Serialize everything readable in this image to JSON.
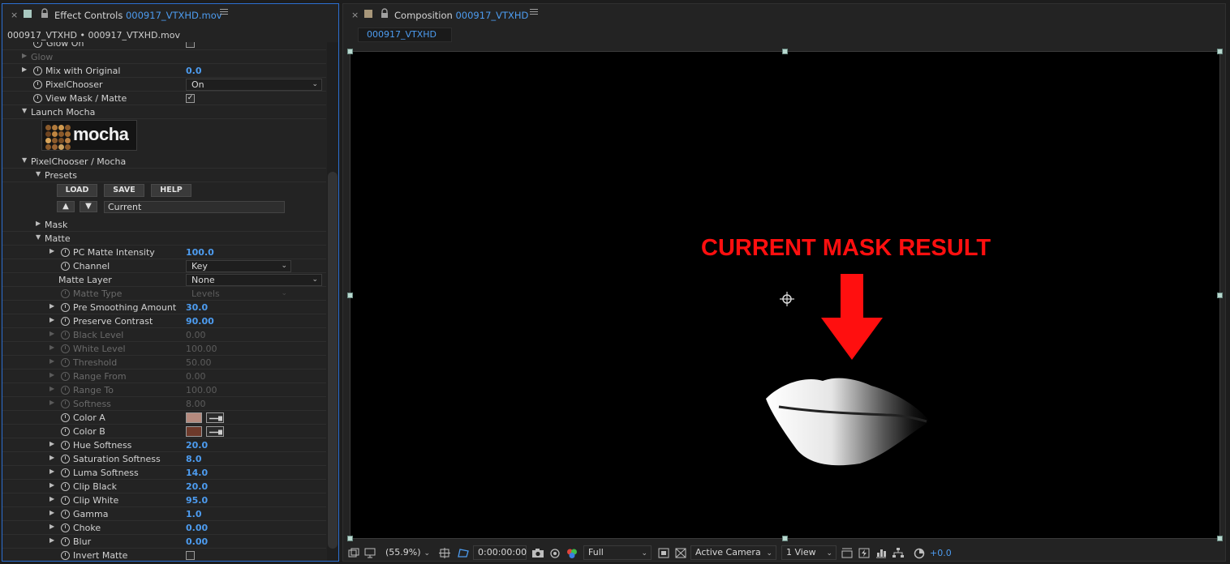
{
  "left_panel": {
    "tab_close": "×",
    "tab_title_prefix": "Effect Controls",
    "tab_title_file": "000917_VTXHD.mov",
    "breadcrumb": "000917_VTXHD • 000917_VTXHD.mov",
    "rows": {
      "glow_on": "Glow On",
      "glow": "Glow",
      "mix_with_original": {
        "label": "Mix with Original",
        "value": "0.0"
      },
      "pixelchooser": {
        "label": "PixelChooser",
        "value": "On"
      },
      "view_mask_matte": {
        "label": "View Mask / Matte",
        "checked": true
      },
      "launch_mocha": "Launch Mocha",
      "mocha_logo_text": "mocha",
      "pixelchooser_mocha": "PixelChooser / Mocha",
      "presets": "Presets",
      "mask": "Mask",
      "matte": "Matte",
      "pc_matte_intensity": {
        "label": "PC Matte Intensity",
        "value": "100.0"
      },
      "channel": {
        "label": "Channel",
        "value": "Key"
      },
      "matte_layer": {
        "label": "Matte Layer",
        "value": "None"
      },
      "matte_type": {
        "label": "Matte Type",
        "value": "Levels"
      },
      "pre_smoothing_amount": {
        "label": "Pre Smoothing Amount",
        "value": "30.0"
      },
      "preserve_contrast": {
        "label": "Preserve Contrast",
        "value": "90.00"
      },
      "black_level": {
        "label": "Black Level",
        "value": "0.00"
      },
      "white_level": {
        "label": "White Level",
        "value": "100.00"
      },
      "threshold": {
        "label": "Threshold",
        "value": "50.00"
      },
      "range_from": {
        "label": "Range From",
        "value": "0.00"
      },
      "range_to": {
        "label": "Range To",
        "value": "100.00"
      },
      "softness": {
        "label": "Softness",
        "value": "8.00"
      },
      "color_a": {
        "label": "Color A",
        "color": "#b58a7e"
      },
      "color_b": {
        "label": "Color B",
        "color": "#6e3a2b"
      },
      "hue_softness": {
        "label": "Hue Softness",
        "value": "20.0"
      },
      "saturation_softness": {
        "label": "Saturation Softness",
        "value": "8.0"
      },
      "luma_softness": {
        "label": "Luma Softness",
        "value": "14.0"
      },
      "clip_black": {
        "label": "Clip Black",
        "value": "20.0"
      },
      "clip_white": {
        "label": "Clip White",
        "value": "95.0"
      },
      "gamma": {
        "label": "Gamma",
        "value": "1.0"
      },
      "choke": {
        "label": "Choke",
        "value": "0.00"
      },
      "blur": {
        "label": "Blur",
        "value": "0.00"
      },
      "invert_matte": {
        "label": "Invert Matte",
        "checked": false
      }
    },
    "preset_buttons": {
      "load": "LOAD",
      "save": "SAVE",
      "help": "HELP"
    },
    "preset_up": "▲",
    "preset_down": "▼",
    "preset_name": "Current"
  },
  "right_panel": {
    "tab_close": "×",
    "tab_title_prefix": "Composition",
    "tab_title_comp": "000917_VTXHD",
    "subtab": "000917_VTXHD",
    "annotation": "CURRENT MASK RESULT",
    "toolbar": {
      "magnification": "(55.9%)",
      "timecode": "0:00:00:00",
      "resolution": "Full",
      "camera": "Active Camera",
      "views": "1 View",
      "exposure": "+0.0"
    }
  },
  "colors": {
    "accent_blue": "#4d9cf0",
    "annotation_red": "#ff0f0f",
    "effect_label_swatch": "#a9c8c0",
    "comp_label_swatch": "#a8977a"
  },
  "icons": [
    "close-icon",
    "label-swatch",
    "lock-icon",
    "panel-menu-icon",
    "stopwatch-icon",
    "twirl-triangle-icon",
    "chevron-down-icon",
    "eyedropper-icon",
    "anchor-point-icon",
    "camera-snapshot-icon",
    "color-channel-icon",
    "grid-icon",
    "exposure-reset-icon"
  ]
}
